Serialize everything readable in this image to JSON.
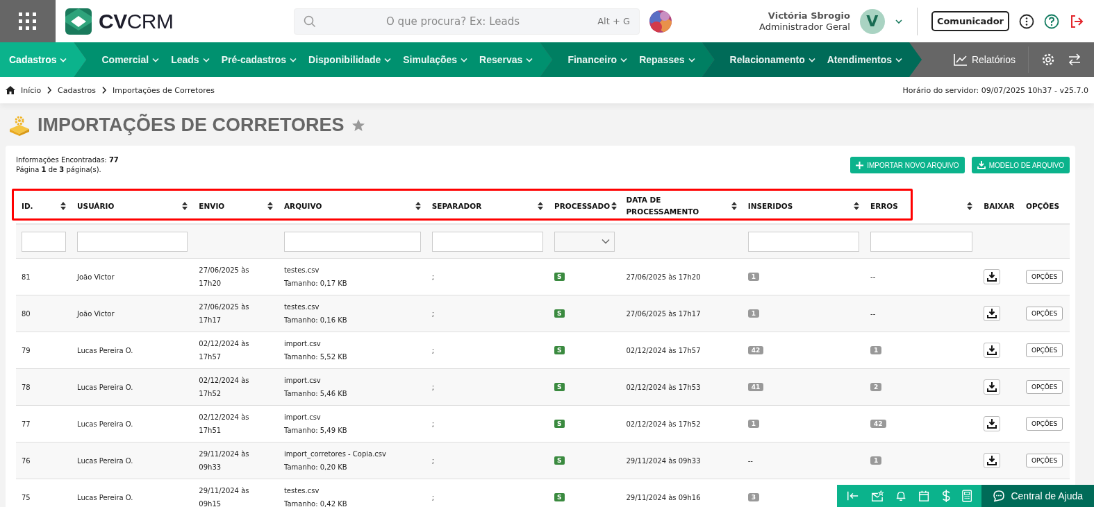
{
  "header": {
    "logo": {
      "bold": "CV",
      "light": "CRM"
    },
    "search": {
      "placeholder": "O que procura? Ex: Leads",
      "shortcut": "Alt + G"
    },
    "user": {
      "name": "Victória Sbrogio",
      "role": "Administrador Geral",
      "initial": "V"
    },
    "communicator_button": "Comunicador"
  },
  "nav": {
    "groups": [
      {
        "color": "#0bb38c",
        "items": [
          {
            "label": "Cadastros",
            "selected": true
          }
        ]
      },
      {
        "color": "#00916f",
        "items": [
          {
            "label": "Comercial",
            "selected": false
          },
          {
            "label": "Leads",
            "selected": false
          },
          {
            "label": "Pré-cadastros",
            "selected": false
          },
          {
            "label": "Disponibilidade",
            "selected": false
          },
          {
            "label": "Simulações",
            "selected": false
          },
          {
            "label": "Reservas",
            "selected": false
          }
        ]
      },
      {
        "color": "#007f62",
        "items": [
          {
            "label": "Financeiro",
            "selected": false
          },
          {
            "label": "Repasses",
            "selected": false
          }
        ]
      },
      {
        "color": "#006b58",
        "items": [
          {
            "label": "Relacionamento",
            "selected": false
          },
          {
            "label": "Atendimentos",
            "selected": false
          }
        ]
      }
    ],
    "reports": "Relatórios"
  },
  "breadcrumb": [
    "Início",
    "Cadastros",
    "Importações de Corretores"
  ],
  "server_time": "Horário do servidor: 09/07/2025 10h37 - v25.7.0",
  "page_title": "IMPORTAÇÕES DE CORRETORES",
  "summary": {
    "found": "Informações Encontradas: **77**",
    "page": "Página **1** de **3** página(s)."
  },
  "actions": [
    "IMPORTAR NOVO ARQUIVO",
    "MODELO DE ARQUIVO"
  ],
  "table": {
    "columns": [
      {
        "label": "ID.",
        "sortable": true,
        "filter": {
          "kind": "text"
        }
      },
      {
        "label": "USUÁRIO",
        "sortable": true,
        "filter": {
          "kind": "text"
        }
      },
      {
        "label": "ENVIO",
        "sortable": true
      },
      {
        "label": "ARQUIVO",
        "sortable": true,
        "filter": {
          "kind": "text"
        }
      },
      {
        "label": "SEPARADOR",
        "sortable": true,
        "filter": {
          "kind": "text"
        }
      },
      {
        "label": "PROCESSADO",
        "sortable": true,
        "filter": {
          "kind": "select"
        }
      },
      {
        "label": "DATA DE PROCESSAMENTO",
        "sortable": true
      },
      {
        "label": "INSERIDOS",
        "sortable": true,
        "filter": {
          "kind": "text"
        }
      },
      {
        "label": "ERROS",
        "sortable": true,
        "filter": {
          "kind": "text"
        }
      },
      {
        "label": "BAIXAR",
        "sortable": false
      },
      {
        "label": "OPÇÕES",
        "sortable": false
      }
    ],
    "rows": [
      {
        "id": "81",
        "user": "João Victor",
        "sent": "27/06/2025 às 17h20",
        "file": "testes.csv",
        "size": "Tamanho: 0,17 KB",
        "separator": ";",
        "processed": "S",
        "processed_at": "27/06/2025 às 17h20",
        "inserted": {
          "kind": "badge",
          "text": "1"
        },
        "errors": {
          "kind": "text",
          "text": "--"
        },
        "options": "OPÇÕES"
      },
      {
        "id": "80",
        "user": "João Victor",
        "sent": "27/06/2025 às 17h17",
        "file": "testes.csv",
        "size": "Tamanho: 0,16 KB",
        "separator": ";",
        "processed": "S",
        "processed_at": "27/06/2025 às 17h17",
        "inserted": {
          "kind": "badge",
          "text": "1"
        },
        "errors": {
          "kind": "text",
          "text": "--"
        },
        "options": "OPÇÕES"
      },
      {
        "id": "79",
        "user": "Lucas Pereira O.",
        "sent": "02/12/2024 às 17h57",
        "file": "import.csv",
        "size": "Tamanho: 5,52 KB",
        "separator": ";",
        "processed": "S",
        "processed_at": "02/12/2024 às 17h57",
        "inserted": {
          "kind": "badge",
          "text": "42"
        },
        "errors": {
          "kind": "badge",
          "text": "1"
        },
        "options": "OPÇÕES"
      },
      {
        "id": "78",
        "user": "Lucas Pereira O.",
        "sent": "02/12/2024 às 17h52",
        "file": "import.csv",
        "size": "Tamanho: 5,46 KB",
        "separator": ";",
        "processed": "S",
        "processed_at": "02/12/2024 às 17h53",
        "inserted": {
          "kind": "badge",
          "text": "41"
        },
        "errors": {
          "kind": "badge",
          "text": "2"
        },
        "options": "OPÇÕES"
      },
      {
        "id": "77",
        "user": "Lucas Pereira O.",
        "sent": "02/12/2024 às 17h51",
        "file": "import.csv",
        "size": "Tamanho: 5,49 KB",
        "separator": ";",
        "processed": "S",
        "processed_at": "02/12/2024 às 17h52",
        "inserted": {
          "kind": "badge",
          "text": "1"
        },
        "errors": {
          "kind": "badge",
          "text": "42"
        },
        "options": "OPÇÕES"
      },
      {
        "id": "76",
        "user": "Lucas Pereira O.",
        "sent": "29/11/2024 às 09h33",
        "file": "import_corretores - Copia.csv",
        "size": "Tamanho: 0,20 KB",
        "separator": ";",
        "processed": "S",
        "processed_at": "29/11/2024 às 09h33",
        "inserted": {
          "kind": "text",
          "text": "--"
        },
        "errors": {
          "kind": "badge",
          "text": "1"
        },
        "options": "OPÇÕES"
      },
      {
        "id": "75",
        "user": "Lucas Pereira O.",
        "sent": "29/11/2024 às 09h15",
        "file": "testes.csv",
        "size": "Tamanho: 0,42 KB",
        "separator": ";",
        "processed": "S",
        "processed_at": "29/11/2024 às 09h16",
        "inserted": {
          "kind": "badge",
          "text": "3"
        }
      }
    ]
  },
  "help_bar": {
    "label": "Central de Ajuda"
  }
}
